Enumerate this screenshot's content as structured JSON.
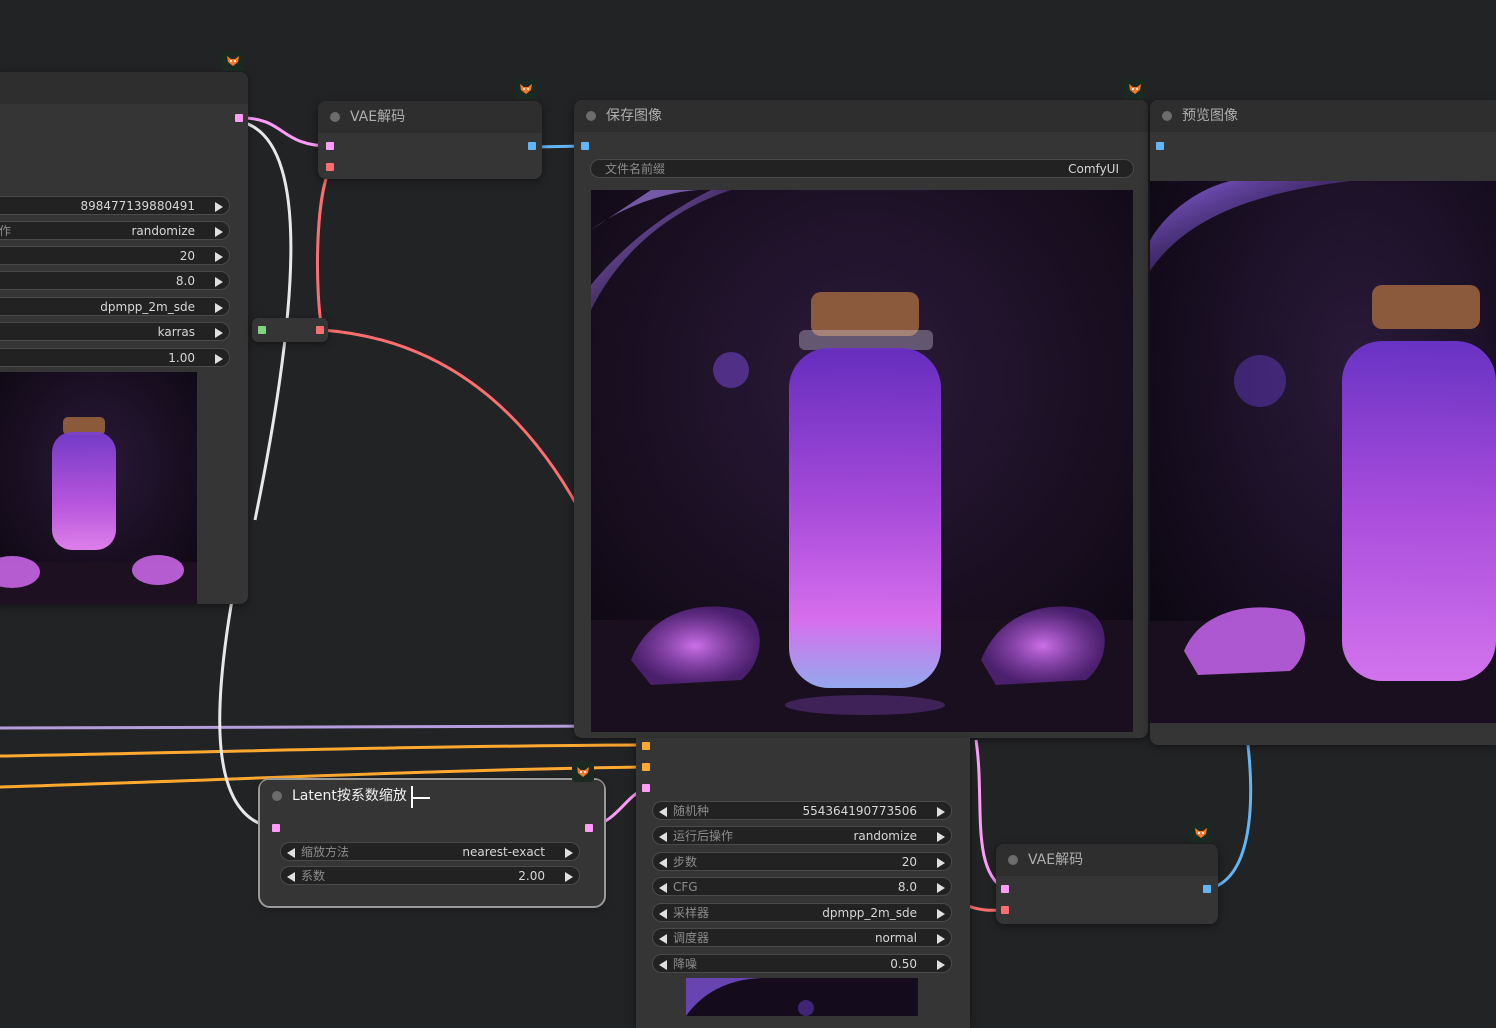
{
  "nodes": {
    "ksampler_left": {
      "widgets": [
        {
          "label": "",
          "value": "898477139880491"
        },
        {
          "label": "作",
          "value": "randomize"
        },
        {
          "label": "",
          "value": "20"
        },
        {
          "label": "",
          "value": "8.0"
        },
        {
          "label": "",
          "value": "dpmpp_2m_sde"
        },
        {
          "label": "",
          "value": "karras"
        },
        {
          "label": "",
          "value": "1.00"
        }
      ]
    },
    "vae_decode_top": {
      "title": "VAE解码"
    },
    "save_image": {
      "title": "保存图像",
      "filename_prefix": {
        "label": "文件名前缀",
        "value": "ComfyUI"
      }
    },
    "preview_image": {
      "title": "预览图像"
    },
    "latent_upscale": {
      "title": "Latent按系数缩放",
      "widgets": [
        {
          "label": "缩放方法",
          "value": "nearest-exact"
        },
        {
          "label": "系数",
          "value": "2.00"
        }
      ]
    },
    "ksampler_bottom": {
      "widgets": [
        {
          "label": "随机种",
          "value": "554364190773506"
        },
        {
          "label": "运行后操作",
          "value": "randomize"
        },
        {
          "label": "步数",
          "value": "20"
        },
        {
          "label": "CFG",
          "value": "8.0"
        },
        {
          "label": "采样器",
          "value": "dpmpp_2m_sde"
        },
        {
          "label": "调度器",
          "value": "normal"
        },
        {
          "label": "降噪",
          "value": "0.50"
        }
      ]
    },
    "vae_decode_bottom": {
      "title": "VAE解码"
    }
  },
  "colors": {
    "canvas": "#222325",
    "node_body": "#353535",
    "node_title": "#2e2e2e",
    "link_latent": "#ff9cf9",
    "link_vae": "#ff6e6e",
    "link_image": "#64b5f6",
    "link_model": "#b39ddb",
    "link_conditioning": "#ffa931",
    "link_clip": "#e8e8e8",
    "port_green": "#7fd67f"
  },
  "icons": {
    "node_badge": "fox-icon",
    "widget_decrement": "triangle-left-icon",
    "widget_increment": "triangle-right-icon"
  }
}
